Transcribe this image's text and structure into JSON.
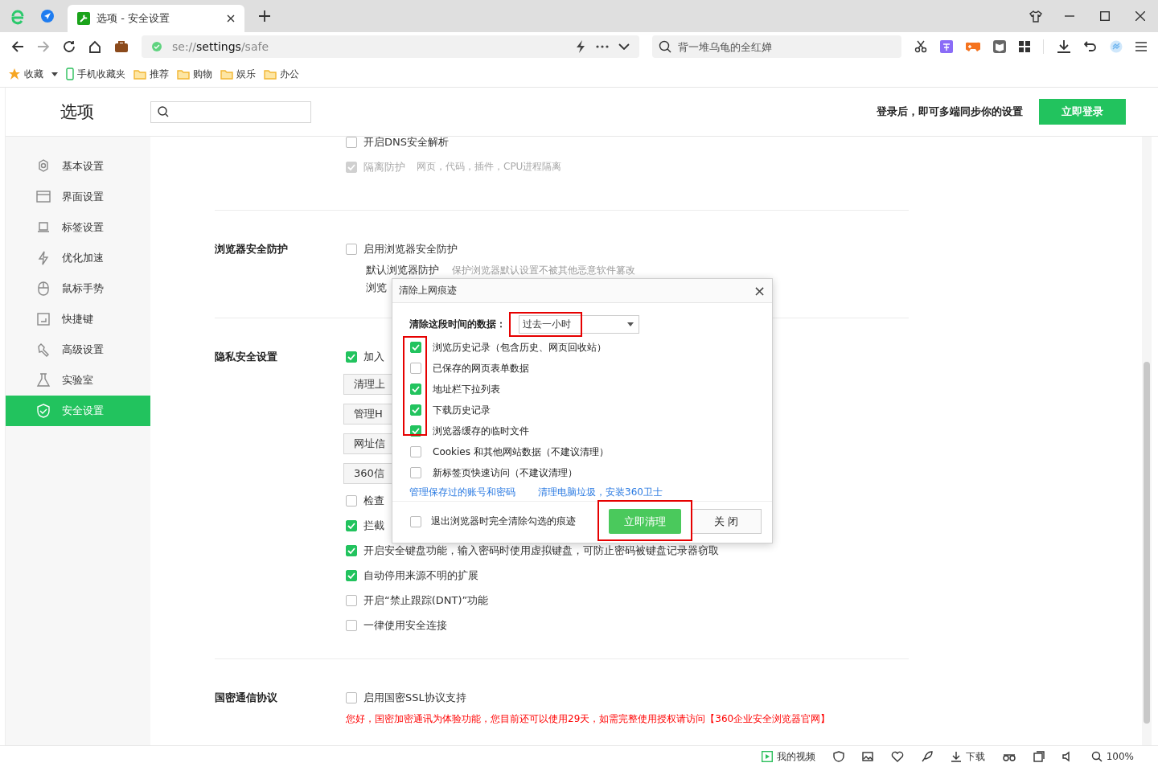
{
  "browser": {
    "tabs": [
      {
        "title": "选项 - 安全设置",
        "selected": true
      }
    ],
    "address": {
      "scheme": "se://",
      "host": "settings",
      "path": "/safe"
    },
    "search": {
      "placeholder": "背一堆乌龟的全红婵"
    },
    "bookmarks": [
      {
        "label": "收藏",
        "kind": "star"
      },
      {
        "label": "手机收藏夹",
        "kind": "phone"
      },
      {
        "label": "推荐",
        "kind": "folder"
      },
      {
        "label": "购物",
        "kind": "folder"
      },
      {
        "label": "娱乐",
        "kind": "folder"
      },
      {
        "label": "办公",
        "kind": "folder"
      }
    ]
  },
  "header": {
    "title": "选项",
    "login_prompt": "登录后，即可多端同步你的设置",
    "login_button": "立即登录"
  },
  "sidebar": {
    "items": [
      {
        "label": "基本设置",
        "selected": false
      },
      {
        "label": "界面设置",
        "selected": false
      },
      {
        "label": "标签设置",
        "selected": false
      },
      {
        "label": "优化加速",
        "selected": false
      },
      {
        "label": "鼠标手势",
        "selected": false
      },
      {
        "label": "快捷键",
        "selected": false
      },
      {
        "label": "高级设置",
        "selected": false
      },
      {
        "label": "实验室",
        "selected": false
      },
      {
        "label": "安全设置",
        "selected": true
      }
    ]
  },
  "sections": [
    {
      "rows": [
        {
          "kind": "checkbox",
          "label": "开启DNS安全解析",
          "checked": false,
          "disabled": false
        },
        {
          "kind": "checkbox",
          "label": "隔离防护",
          "note": "网页，代码，插件，CPU进程隔离",
          "checked": true,
          "disabled": true
        }
      ]
    },
    {
      "title": "浏览器安全防护",
      "rows": [
        {
          "kind": "checkbox",
          "label": "启用浏览器安全防护",
          "checked": false,
          "disabled": false
        },
        {
          "kind": "subline",
          "label": "默认浏览器防护",
          "note": "保护浏览器默认设置不被其他恶意软件篡改"
        },
        {
          "kind": "subline",
          "label": "浏览"
        }
      ]
    },
    {
      "title": "隐私安全设置",
      "rows": [
        {
          "kind": "checkbox",
          "label": "加入",
          "checked": true,
          "disabled": false
        },
        {
          "kind": "button",
          "label": "清理上"
        },
        {
          "kind": "button",
          "label": "管理H"
        },
        {
          "kind": "button",
          "label": "网址信"
        },
        {
          "kind": "button",
          "label": "360信"
        },
        {
          "kind": "checkbox",
          "label": "检查",
          "checked": false,
          "disabled": false
        },
        {
          "kind": "checkbox",
          "label": "拦截",
          "checked": true,
          "disabled": false
        },
        {
          "kind": "checkbox",
          "label": "开启安全键盘功能，输入密码时使用虚拟键盘，可防止密码被键盘记录器窃取",
          "checked": true,
          "disabled": false
        },
        {
          "kind": "checkbox",
          "label": "自动停用来源不明的扩展",
          "checked": true,
          "disabled": false
        },
        {
          "kind": "checkbox",
          "label": "开启“禁止跟踪(DNT)”功能",
          "checked": false,
          "disabled": false
        },
        {
          "kind": "checkbox",
          "label": "一律使用安全连接",
          "checked": false,
          "disabled": false
        }
      ]
    },
    {
      "title": "国密通信协议",
      "rows": [
        {
          "kind": "checkbox",
          "label": "启用国密SSL协议支持",
          "checked": false,
          "disabled": false
        },
        {
          "kind": "warning",
          "label": "您好，国密加密通讯为体验功能，您目前还可以使用29天，如需完整使用授权请访问【360企业安全浏览器官网】"
        }
      ]
    }
  ],
  "dialog": {
    "title": "清除上网痕迹",
    "close": "×",
    "range_label": "清除这段时间的数据：",
    "range_value": "过去一小时",
    "range_highlighted": true,
    "options_highlighted": true,
    "options": [
      {
        "label": "浏览历史记录（包含历史、网页回收站）",
        "checked": true
      },
      {
        "label": "已保存的网页表单数据",
        "checked": false
      },
      {
        "label": "地址栏下拉列表",
        "checked": true
      },
      {
        "label": "下载历史记录",
        "checked": true
      },
      {
        "label": "浏览器缓存的临时文件",
        "checked": true
      },
      {
        "label": "Cookies 和其他网站数据（不建议清理）",
        "checked": false
      },
      {
        "label": "新标签页快速访问（不建议清理）",
        "checked": false
      }
    ],
    "links": [
      "管理保存过的账号和密码",
      "清理电脑垃圾，安装360卫士"
    ],
    "exit_option": {
      "label": "退出浏览器时完全清除勾选的痕迹",
      "checked": false
    },
    "clear_button": {
      "label": "立即清理",
      "highlighted": true
    },
    "close_button": "关 闭"
  },
  "status_bar": {
    "video": "我的视频",
    "download": "下载",
    "zoom": "100%"
  }
}
